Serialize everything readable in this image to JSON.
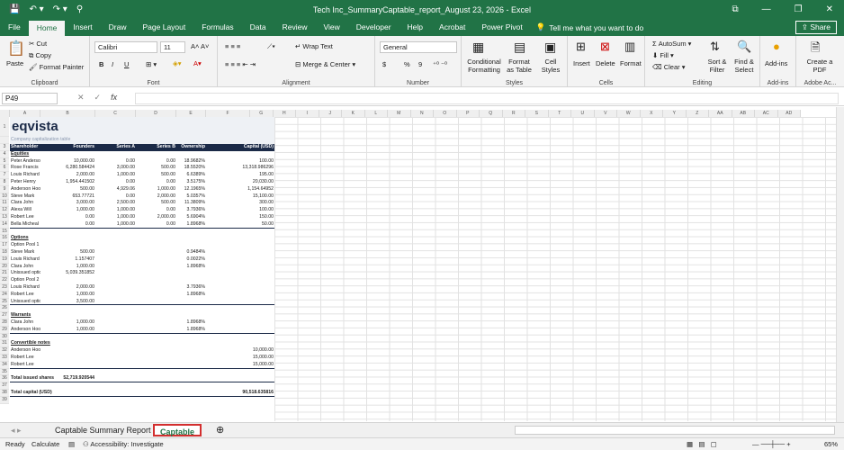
{
  "window": {
    "title": "Tech Inc_SummaryCaptable_report_August 23, 2026  -  Excel",
    "qat": [
      "💾",
      "↶ ▾",
      "↷ ▾",
      "⚲"
    ],
    "controls": [
      "⧉",
      "—",
      "❐",
      "✕"
    ]
  },
  "ribbon_tabs": [
    "File",
    "Home",
    "Insert",
    "Draw",
    "Page Layout",
    "Formulas",
    "Data",
    "Review",
    "View",
    "Developer",
    "Help",
    "Acrobat",
    "Power Pivot"
  ],
  "tell_me": "Tell me what you want to do",
  "share_label": "Share",
  "ribbon": {
    "clipboard": {
      "label": "Clipboard",
      "paste": "Paste",
      "cut": "Cut",
      "copy": "Copy",
      "format_painter": "Format Painter"
    },
    "font": {
      "label": "Font",
      "family": "Calibri",
      "size": "11",
      "bold": "B",
      "italic": "I",
      "underline": "U"
    },
    "alignment": {
      "label": "Alignment",
      "wrap": "Wrap Text",
      "merge": "Merge & Center"
    },
    "number": {
      "label": "Number",
      "format": "General",
      "currency": "$",
      "percent": "%",
      "comma": "9"
    },
    "styles": {
      "label": "Styles",
      "conditional": "Conditional Formatting",
      "format_table": "Format as Table",
      "cell_styles": "Cell Styles"
    },
    "cells": {
      "label": "Cells",
      "insert": "Insert",
      "delete": "Delete",
      "format": "Format"
    },
    "editing": {
      "label": "Editing",
      "autosum": "AutoSum",
      "fill": "Fill",
      "clear": "Clear",
      "sort": "Sort & Filter",
      "find": "Find & Select"
    },
    "addins": {
      "label": "Add-ins",
      "addins": "Add-ins"
    },
    "adobe": {
      "label": "Adobe Ac...",
      "create_pdf": "Create a PDF"
    }
  },
  "name_box": "P49",
  "columns": [
    "A",
    "B",
    "C",
    "D",
    "E",
    "F",
    "G",
    "H",
    "I",
    "J",
    "K",
    "L",
    "M",
    "N",
    "O",
    "P",
    "Q",
    "R",
    "S",
    "T",
    "U",
    "V",
    "W",
    "X",
    "Y",
    "Z",
    "AA",
    "AB",
    "AC",
    "AD"
  ],
  "sheet": {
    "logo": "eqvista",
    "subtitle": "Company capitalization table",
    "headers": [
      "Shareholder",
      "Founders",
      "Series A",
      "Series B",
      "Ownership",
      "Capital (USD)"
    ],
    "equities_label": "Equities",
    "equities": [
      [
        "Peter Anderson",
        "10,000.00",
        "0.00",
        "0.00",
        "18.9682%",
        "100.00"
      ],
      [
        "Rose Francis",
        "6,280.584424",
        "3,000.00",
        "500.00",
        "18.5520%",
        "13,318.986296"
      ],
      [
        "Louis Richard",
        "2,000.00",
        "1,000.00",
        "500.00",
        "6.6389%",
        "195.00"
      ],
      [
        "Peter Henry",
        "1,954.441502",
        "0.00",
        "0.00",
        "3.5175%",
        "20,030.00"
      ],
      [
        "Anderson Hooper",
        "500.00",
        "4,929.06",
        "1,000.00",
        "12.1965%",
        "1,154.64952"
      ],
      [
        "Steve Mark",
        "653.77721",
        "0.00",
        "2,000.00",
        "5.0357%",
        "15,100.00"
      ],
      [
        "Clara John",
        "3,000.00",
        "2,500.00",
        "500.00",
        "11.3809%",
        "300.00"
      ],
      [
        "Alexa Will",
        "1,000.00",
        "1,000.00",
        "0.00",
        "3.7936%",
        "100.00"
      ],
      [
        "Robert Lee",
        "0.00",
        "1,000.00",
        "2,000.00",
        "5.6904%",
        "150.00"
      ],
      [
        "Bella Micheal",
        "0.00",
        "1,000.00",
        "0.00",
        "1.8968%",
        "50.00"
      ]
    ],
    "options_label": "Options",
    "pool1_label": "Option Pool 1",
    "pool1": [
      [
        "Steve Mark",
        "500.00",
        "",
        "",
        "0.9484%",
        ""
      ],
      [
        "Louis Richard",
        "1.157407",
        "",
        "",
        "0.0022%",
        ""
      ],
      [
        "Clara John",
        "1,000.00",
        "",
        "",
        "1.8968%",
        ""
      ],
      [
        "Unissued options",
        "5,039.351852",
        "",
        "",
        "",
        ""
      ]
    ],
    "pool2_label": "Option Pool 2",
    "pool2": [
      [
        "Louis Richard",
        "2,000.00",
        "",
        "",
        "3.7936%",
        ""
      ],
      [
        "Robert Lee",
        "1,000.00",
        "",
        "",
        "1.8968%",
        ""
      ],
      [
        "Unissued options",
        "3,500.00",
        "",
        "",
        "",
        ""
      ]
    ],
    "warrants_label": "Warrants",
    "warrants": [
      [
        "Clara John",
        "1,000.00",
        "",
        "",
        "1.8968%",
        ""
      ],
      [
        "Anderson Hooper",
        "1,000.00",
        "",
        "",
        "1.8968%",
        ""
      ]
    ],
    "convertible_label": "Convertible notes",
    "convertible": [
      [
        "Anderson Hooper",
        "",
        "",
        "",
        "",
        "10,000.00"
      ],
      [
        "Robert Lee",
        "",
        "",
        "",
        "",
        "15,000.00"
      ],
      [
        "Robert Lee",
        "",
        "",
        "",
        "",
        "15,000.00"
      ]
    ],
    "total_issued_label": "Total issued shares",
    "total_issued_value": "52,719.920544",
    "total_capital_label": "Total capital (USD)",
    "total_capital_value": "90,518.635816"
  },
  "sheet_tabs": [
    "Captable Summary Report",
    "Captable"
  ],
  "status": {
    "ready": "Ready",
    "calculate": "Calculate",
    "accessibility": "Accessibility: Investigate",
    "zoom": "65%"
  }
}
